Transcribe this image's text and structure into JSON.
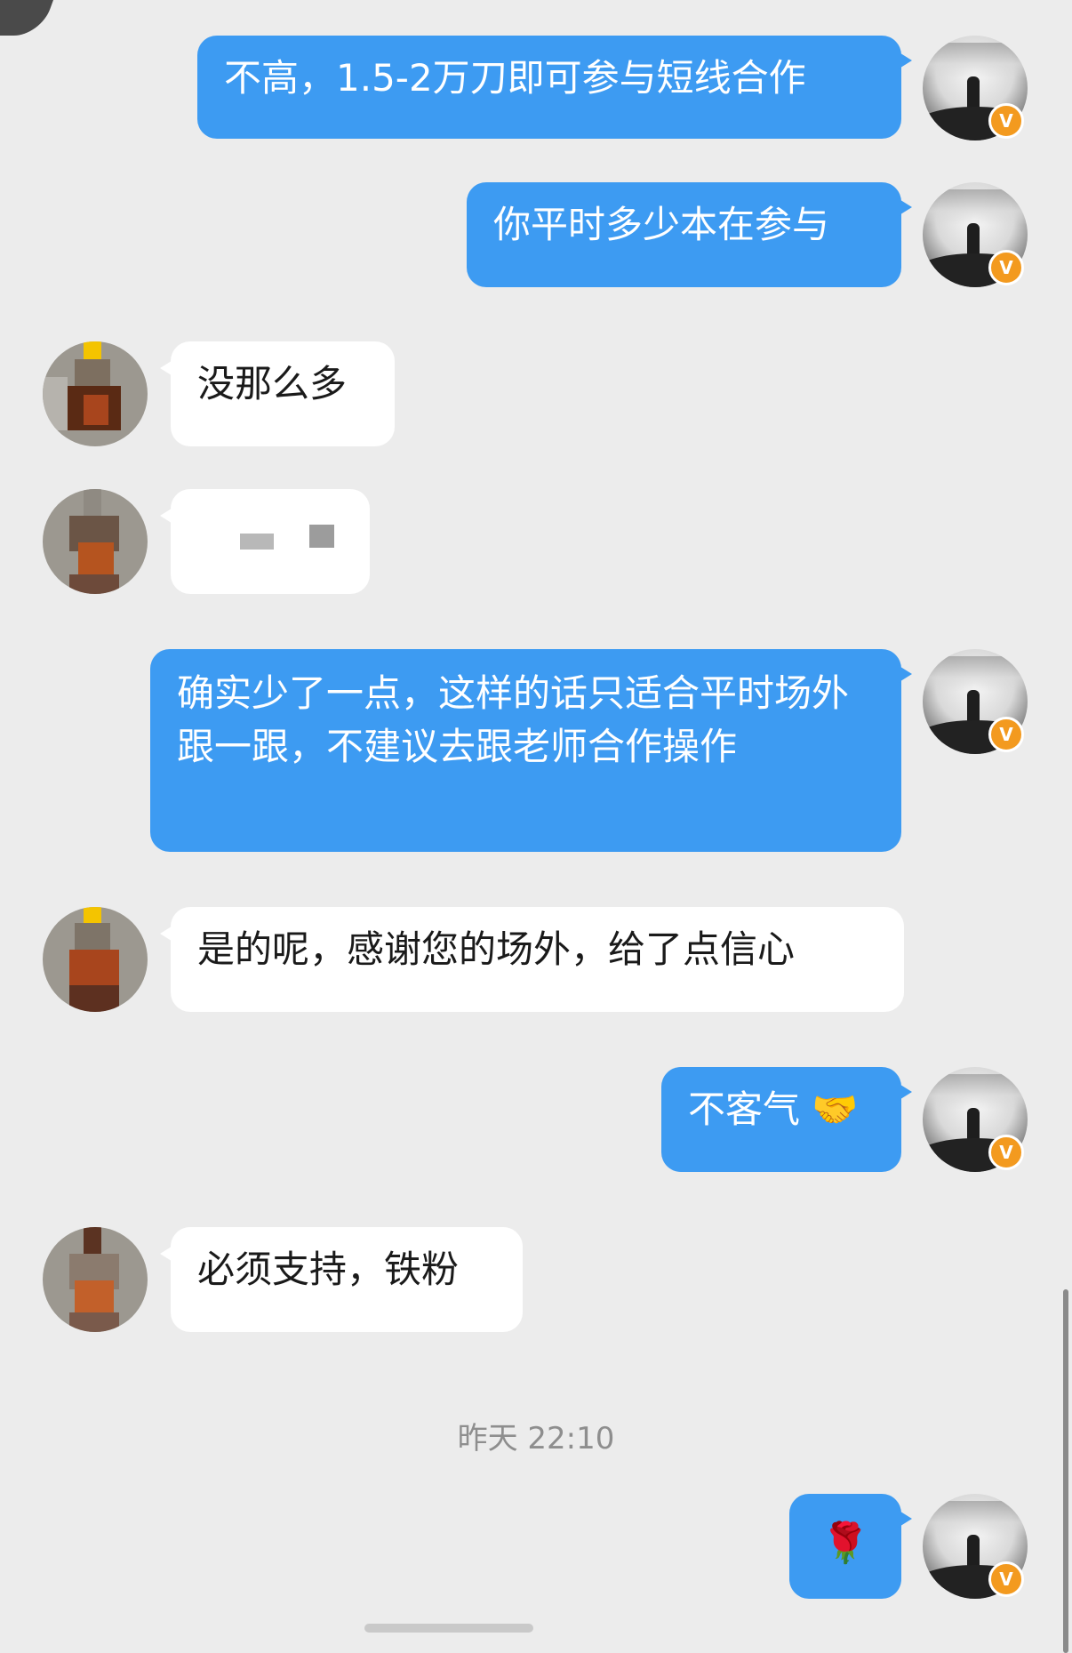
{
  "colors": {
    "background": "#ececec",
    "my_bubble": "#3d9bf2",
    "their_bubble": "#ffffff",
    "badge": "#f39a1f",
    "timestamp_text": "#8e8e8e"
  },
  "messages": [
    {
      "sender": "me",
      "text": "不高，1.5-2万刀即可参与短线合作"
    },
    {
      "sender": "me",
      "text": "你平时多少本在参与"
    },
    {
      "sender": "them",
      "text": "没那么多"
    },
    {
      "sender": "them",
      "text": "",
      "redacted": true
    },
    {
      "sender": "me",
      "text": "确实少了一点，这样的话只适合平时场外跟一跟，不建议去跟老师合作操作"
    },
    {
      "sender": "them",
      "text": "是的呢，感谢您的场外，给了点信心"
    },
    {
      "sender": "me",
      "text": "不客气",
      "emoji": "🤝"
    },
    {
      "sender": "them",
      "text": "必须支持，铁粉"
    },
    {
      "sender": "me",
      "text": "",
      "emoji": "🌹"
    }
  ],
  "timestamp": "昨天 22:10",
  "my_avatar": {
    "badge_label": "V",
    "icon": "verified-badge-icon"
  }
}
